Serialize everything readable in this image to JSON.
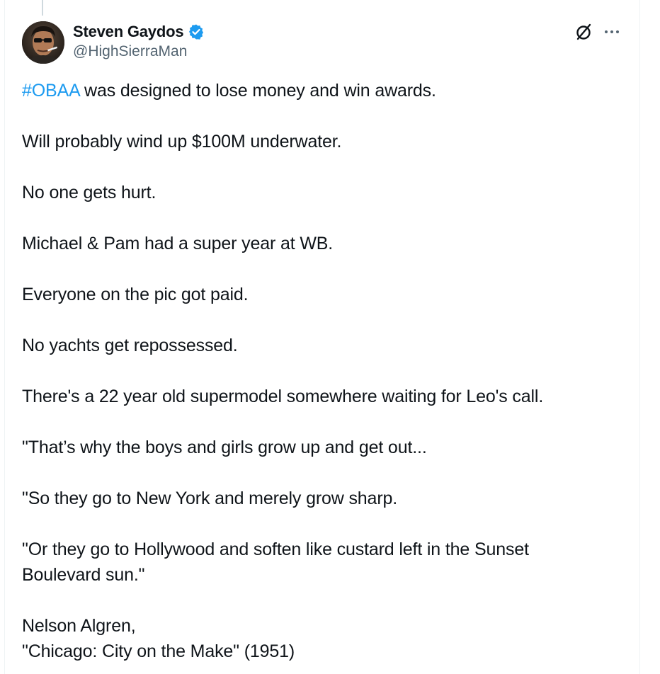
{
  "author": {
    "display_name": "Steven Gaydos",
    "handle": "@HighSierraMan",
    "verified": true,
    "verified_color": "#1d9bf0",
    "avatar_icon": "profile-photo"
  },
  "actions": {
    "grok_icon": "grok-slash-circle-icon",
    "more_icon": "more-dots-icon"
  },
  "tweet": {
    "hashtag": "#OBAA",
    "line1_rest": " was designed to lose money and win awards.",
    "line2": "Will probably wind up $100M underwater.",
    "line3": "No one gets hurt.",
    "line4": "Michael & Pam had a super year at WB.",
    "line5": "Everyone on the pic got paid.",
    "line6": "No yachts get repossessed.",
    "line7": "There's a 22 year old supermodel somewhere waiting for Leo's call.",
    "line8": "\"That’s why the boys and girls grow up and get out...",
    "line9": "\"So they go to New York and merely grow sharp.",
    "line10a": "\"Or they go to Hollywood and soften like custard left in the Sunset",
    "line10b": "Boulevard sun.\"",
    "line11a": "Nelson Algren,",
    "line11b": "\"Chicago: City on the Make\" (1951)"
  },
  "colors": {
    "text": "#0f1419",
    "secondary": "#536471",
    "link": "#1d9bf0",
    "border": "#eff3f4"
  }
}
